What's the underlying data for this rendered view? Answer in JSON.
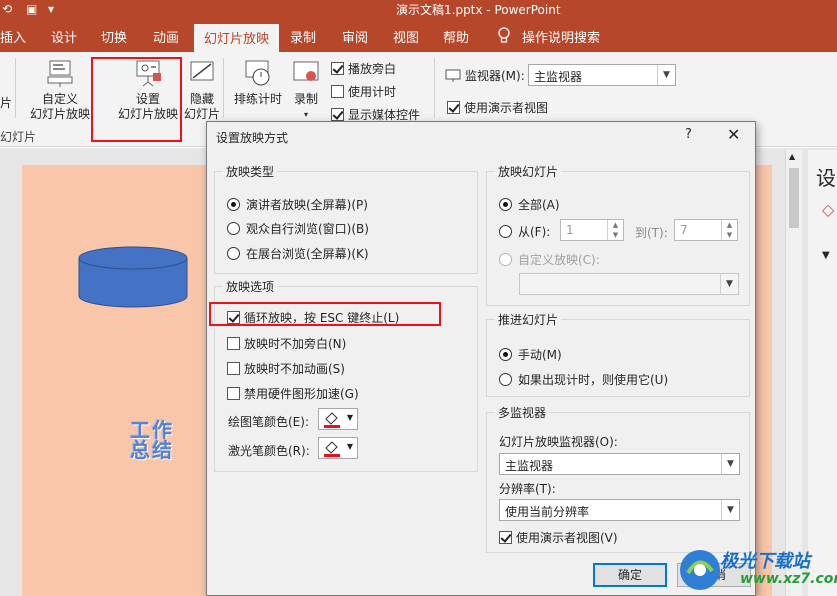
{
  "window": {
    "title": "演示文稿1.pptx  -  PowerPoint"
  },
  "tabs": [
    "插入",
    "设计",
    "切换",
    "动画",
    "幻灯片放映",
    "录制",
    "审阅",
    "视图",
    "帮助"
  ],
  "active_tab": "幻灯片放映",
  "help_search": "操作说明搜索",
  "ribbon": {
    "left_cut": "片",
    "custom_show": "自定义\n幻灯片放映",
    "setup_show": "设置\n幻灯片放映",
    "hide_slide": "隐藏\n幻灯片",
    "rehearse": "排练计时",
    "record": "录制",
    "checks": [
      {
        "label": "播放旁白",
        "checked": true
      },
      {
        "label": "使用计时",
        "checked": false
      },
      {
        "label": "显示媒体控件",
        "checked": true
      }
    ],
    "monitor_label": "监视器(M):",
    "monitor_value": "主监视器",
    "presenter_view": "使用演示者视图",
    "group_label": "幻灯片"
  },
  "slide": {
    "wordart": "工作\n总结"
  },
  "side_panel": {
    "title_cut": "设"
  },
  "dialog": {
    "title": "设置放映方式",
    "help": "?",
    "close": "✕",
    "show_type": {
      "title": "放映类型",
      "options": [
        "演讲者放映(全屏幕)(P)",
        "观众自行浏览(窗口)(B)",
        "在展台浏览(全屏幕)(K)"
      ],
      "selected": 0
    },
    "show_options": {
      "title": "放映选项",
      "checks": [
        {
          "label": "循环放映，按 ESC 键终止(L)",
          "checked": true
        },
        {
          "label": "放映时不加旁白(N)",
          "checked": false
        },
        {
          "label": "放映时不加动画(S)",
          "checked": false
        },
        {
          "label": "禁用硬件图形加速(G)",
          "checked": false
        }
      ],
      "pen_color_label": "绘图笔颜色(E):",
      "laser_color_label": "激光笔颜色(R):",
      "pen_color": "#e81123",
      "laser_color": "#e81123"
    },
    "show_slides": {
      "title": "放映幻灯片",
      "all": "全部(A)",
      "from": "从(F):",
      "from_value": "1",
      "to": "到(T):",
      "to_value": "7",
      "custom": "自定义放映(C):",
      "custom_value": ""
    },
    "advance": {
      "title": "推进幻灯片",
      "manual": "手动(M)",
      "timings": "如果出现计时，则使用它(U)"
    },
    "multi_monitor": {
      "title": "多监视器",
      "monitor_label": "幻灯片放映监视器(O):",
      "monitor_value": "主监视器",
      "resolution_label": "分辨率(T):",
      "resolution_value": "使用当前分辨率",
      "presenter_view": "使用演示者视图(V)"
    },
    "ok": "确定",
    "cancel": "取消"
  },
  "watermark": {
    "text1": "极光下载站",
    "text2": "www.xz7.com"
  }
}
